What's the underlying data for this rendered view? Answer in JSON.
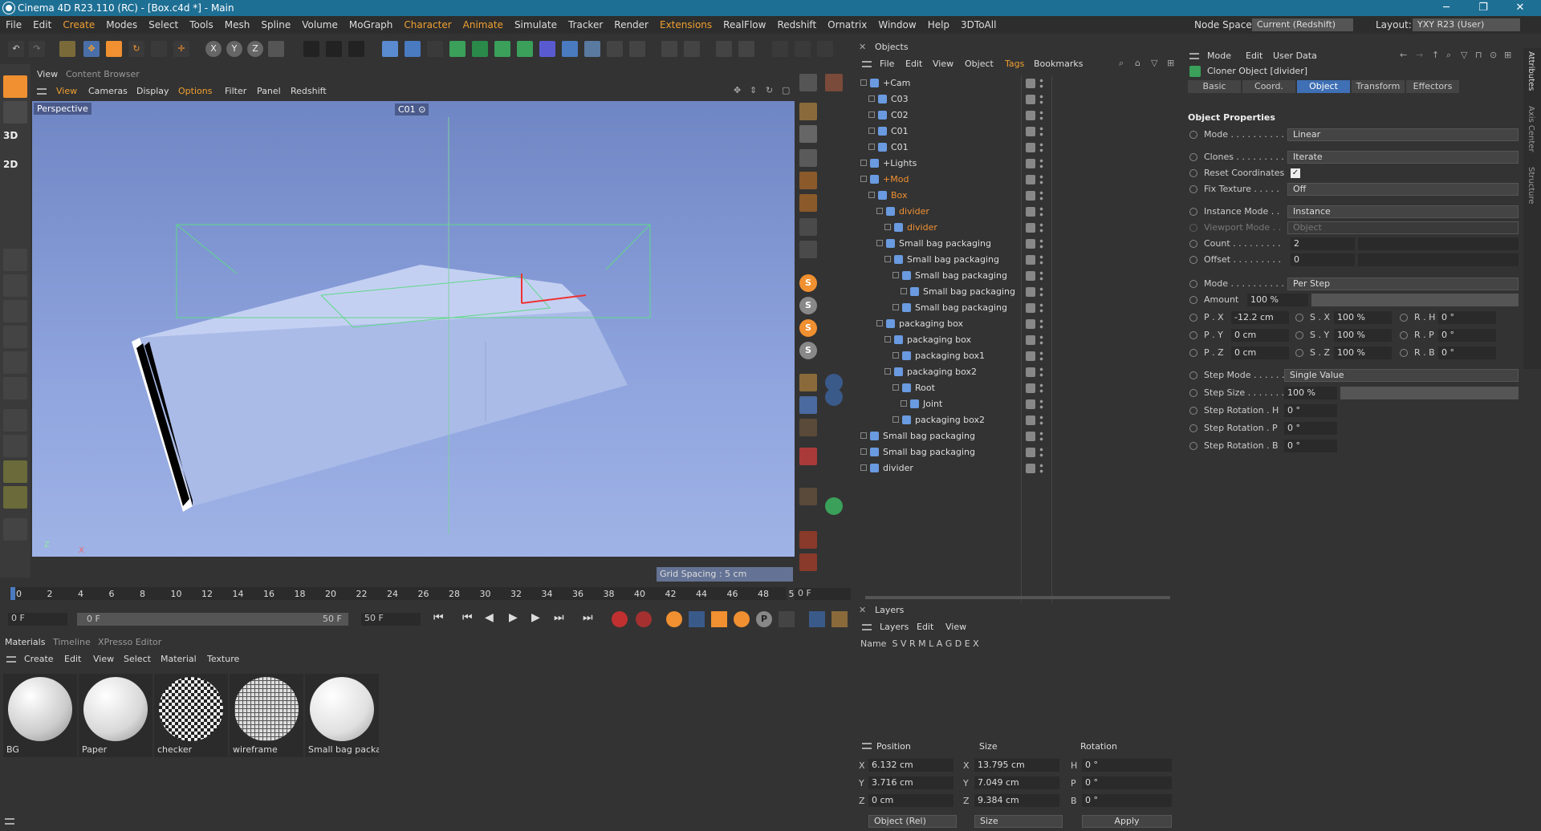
{
  "window": {
    "title": "Cinema 4D R23.110 (RC) - [Box.c4d *] - Main"
  },
  "menu": {
    "items": [
      "File",
      "Edit",
      "Create",
      "Modes",
      "Select",
      "Tools",
      "Mesh",
      "Spline",
      "Volume",
      "MoGraph",
      "Character",
      "Animate",
      "Simulate",
      "Tracker",
      "Render",
      "Extensions",
      "RealFlow",
      "Redshift",
      "Ornatrix",
      "Window",
      "Help",
      "3DToAll"
    ],
    "node_space_label": "Node Space:",
    "node_space_value": "Current (Redshift)",
    "layout_label": "Layout:",
    "layout_value": "YXY R23 (User)"
  },
  "viewport": {
    "tabs": [
      "View",
      "Content Browser"
    ],
    "menu": [
      "View",
      "Cameras",
      "Display",
      "Options",
      "Filter",
      "Panel",
      "Redshift"
    ],
    "label": "Perspective",
    "camera": "C01",
    "grid_spacing": "Grid Spacing : 5 cm",
    "axis_z": "Z",
    "axis_x": "X"
  },
  "timeline": {
    "ticks": [
      "0",
      "2",
      "4",
      "6",
      "8",
      "10",
      "12",
      "14",
      "16",
      "18",
      "20",
      "22",
      "24",
      "26",
      "28",
      "30",
      "32",
      "34",
      "36",
      "38",
      "40",
      "42",
      "44",
      "46",
      "48",
      "50"
    ],
    "current_frame": "0 F",
    "start_field": "0 F",
    "range_start": "0 F",
    "range_end": "50 F",
    "end_field": "50 F"
  },
  "materials": {
    "tabs": [
      "Materials",
      "Timeline",
      "XPresso Editor"
    ],
    "menu": [
      "Create",
      "Edit",
      "View",
      "Select",
      "Material",
      "Texture"
    ],
    "items": [
      {
        "name": "BG"
      },
      {
        "name": "Paper"
      },
      {
        "name": "checker"
      },
      {
        "name": "wireframe"
      },
      {
        "name": "Small bag packa"
      }
    ]
  },
  "objects": {
    "title": "Objects",
    "menu": [
      "File",
      "Edit",
      "View",
      "Object",
      "Tags",
      "Bookmarks"
    ],
    "rows": [
      {
        "name": "+Cam",
        "indent": 0,
        "orange": false
      },
      {
        "name": "C03",
        "indent": 1,
        "orange": false
      },
      {
        "name": "C02",
        "indent": 1,
        "orange": false
      },
      {
        "name": "C01",
        "indent": 1,
        "orange": false
      },
      {
        "name": "C01",
        "indent": 1,
        "orange": false
      },
      {
        "name": "+Lights",
        "indent": 0,
        "orange": false
      },
      {
        "name": "+Mod",
        "indent": 0,
        "orange": true
      },
      {
        "name": "Box",
        "indent": 1,
        "orange": true
      },
      {
        "name": "divider",
        "indent": 2,
        "orange": true
      },
      {
        "name": "divider",
        "indent": 3,
        "orange": true
      },
      {
        "name": "Small bag packaging",
        "indent": 2,
        "orange": false
      },
      {
        "name": "Small bag packaging",
        "indent": 3,
        "orange": false
      },
      {
        "name": "Small bag packaging",
        "indent": 4,
        "orange": false
      },
      {
        "name": "Small bag packaging",
        "indent": 5,
        "orange": false
      },
      {
        "name": "Small bag packaging",
        "indent": 4,
        "orange": false
      },
      {
        "name": "packaging box",
        "indent": 2,
        "orange": false
      },
      {
        "name": "packaging box",
        "indent": 3,
        "orange": false
      },
      {
        "name": "packaging box1",
        "indent": 4,
        "orange": false
      },
      {
        "name": "packaging box2",
        "indent": 3,
        "orange": false
      },
      {
        "name": "Root",
        "indent": 4,
        "orange": false
      },
      {
        "name": "Joint",
        "indent": 5,
        "orange": false
      },
      {
        "name": "packaging box2",
        "indent": 4,
        "orange": false
      },
      {
        "name": "Small bag packaging",
        "indent": 0,
        "orange": false
      },
      {
        "name": "Small bag packaging",
        "indent": 0,
        "orange": false
      },
      {
        "name": "divider",
        "indent": 0,
        "orange": false
      }
    ]
  },
  "layers": {
    "title": "Layers",
    "menu": [
      "Layers",
      "Edit",
      "View"
    ],
    "header": "Name  S V R M L A G D E X"
  },
  "coords": {
    "headers": [
      "Position",
      "Size",
      "Rotation"
    ],
    "rows": [
      {
        "axis": "X",
        "pos": "6.132 cm",
        "size_axis": "X",
        "size": "13.795 cm",
        "rot_axis": "H",
        "rot": "0 °"
      },
      {
        "axis": "Y",
        "pos": "3.716 cm",
        "size_axis": "Y",
        "size": "7.049 cm",
        "rot_axis": "P",
        "rot": "0 °"
      },
      {
        "axis": "Z",
        "pos": "0 cm",
        "size_axis": "Z",
        "size": "9.384 cm",
        "rot_axis": "B",
        "rot": "0 °"
      }
    ],
    "mode": "Object (Rel)",
    "size_mode": "Size",
    "apply": "Apply"
  },
  "attributes": {
    "menu": [
      "Mode",
      "Edit",
      "User Data"
    ],
    "object_title": "Cloner Object [divider]",
    "tabs": [
      "Basic",
      "Coord.",
      "Object",
      "Transform",
      "Effectors"
    ],
    "active_tab": "Object",
    "section": "Object Properties",
    "mode_label": "Mode . . . . . . . . . . .",
    "mode_value": "Linear",
    "clones_label": "Clones . . . . . . . . .",
    "clones_value": "Iterate",
    "reset_label": "Reset Coordinates",
    "fix_label": "Fix Texture . . . . .",
    "fix_value": "Off",
    "instance_label": "Instance Mode . .",
    "instance_value": "Instance",
    "viewport_label": "Viewport Mode . .",
    "viewport_value": "Object",
    "count_label": "Count . . . . . . . . .",
    "count_value": "2",
    "offset_label": "Offset . . . . . . . . .",
    "offset_value": "0",
    "mode2_label": "Mode . . . . . . . . . . .",
    "mode2_value": "Per Step",
    "amount_label": "Amount",
    "amount_value": "100 %",
    "px_label": "P . X",
    "px_value": "-12.2 cm",
    "py_label": "P . Y",
    "py_value": "0 cm",
    "pz_label": "P . Z",
    "pz_value": "0 cm",
    "sx_label": "S . X",
    "sx_value": "100 %",
    "sy_label": "S . Y",
    "sy_value": "100 %",
    "sz_label": "S . Z",
    "sz_value": "100 %",
    "rh_label": "R . H",
    "rh_value": "0 °",
    "rp_label": "R . P",
    "rp_value": "0 °",
    "rb_label": "R . B",
    "rb_value": "0 °",
    "stepmode_label": "Step Mode . . . . . .",
    "stepmode_value": "Single Value",
    "stepsize_label": "Step Size . . . . . . .",
    "stepsize_value": "100 %",
    "srh_label": "Step Rotation . H",
    "srh_value": "0 °",
    "srp_label": "Step Rotation . P",
    "srp_value": "0 °",
    "srb_label": "Step Rotation . B",
    "srb_value": "0 °",
    "side_tabs": [
      "Attributes",
      "Axis Center",
      "Structure"
    ]
  },
  "colors": {
    "title_bar": "#1e6f94",
    "accent_orange": "#f09030",
    "active_tab_blue": "#3f6fb4",
    "viewport_top": "#6f86c4",
    "viewport_bottom": "#9fb3e6"
  }
}
